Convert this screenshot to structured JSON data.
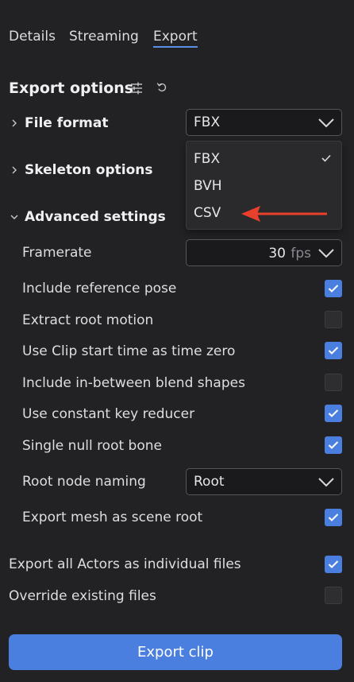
{
  "tabs": [
    {
      "label": "Details"
    },
    {
      "label": "Streaming"
    },
    {
      "label": "Export",
      "active": true
    }
  ],
  "section": {
    "title": "Export options"
  },
  "file_format": {
    "label": "File format",
    "value": "FBX"
  },
  "dropdown": {
    "options": [
      "FBX",
      "BVH",
      "CSV"
    ],
    "selected": "FBX",
    "annotation_arrow_color": "#e8402a"
  },
  "skeleton": {
    "label": "Skeleton options"
  },
  "advanced": {
    "label": "Advanced settings",
    "framerate": {
      "label": "Framerate",
      "value": "30",
      "unit": "fps"
    },
    "options": [
      {
        "label": "Include reference pose",
        "checked": true
      },
      {
        "label": "Extract root motion",
        "checked": false
      },
      {
        "label": "Use Clip start time as time zero",
        "checked": true
      },
      {
        "label": "Include in-between blend shapes",
        "checked": false
      },
      {
        "label": "Use constant key reducer",
        "checked": true
      },
      {
        "label": "Single null root bone",
        "checked": true
      }
    ],
    "root_naming": {
      "label": "Root node naming",
      "value": "Root"
    },
    "export_mesh": {
      "label": "Export mesh as scene root",
      "checked": true
    }
  },
  "global": [
    {
      "label": "Export all Actors as individual files",
      "checked": true
    },
    {
      "label": "Override existing files",
      "checked": false
    }
  ],
  "export_button": {
    "label": "Export clip"
  },
  "colors": {
    "accent": "#4a7fe0",
    "background": "#222224",
    "arrow": "#e8402a"
  }
}
